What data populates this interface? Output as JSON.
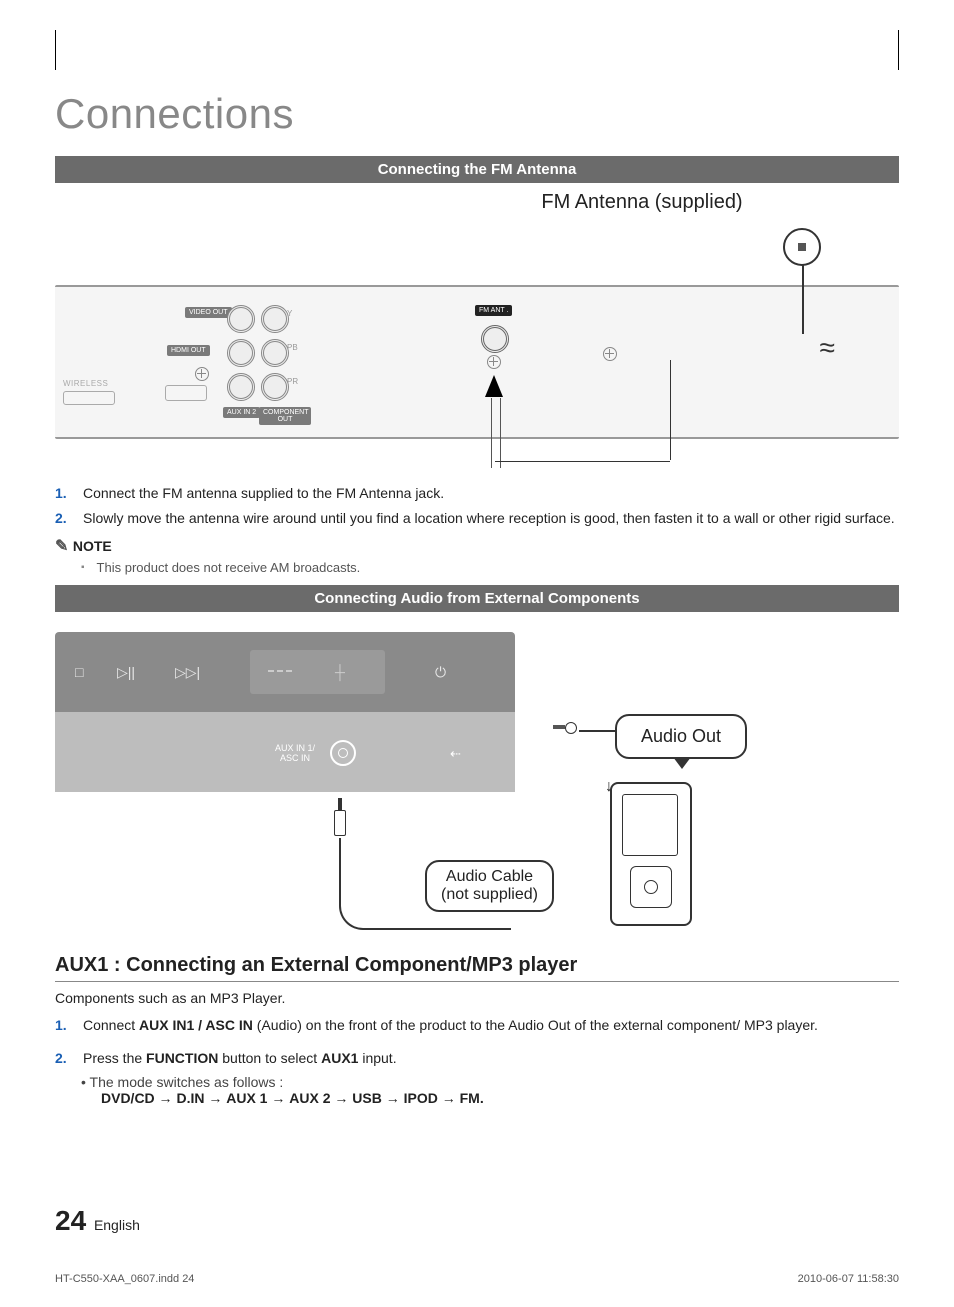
{
  "title": "Connections",
  "section1": {
    "bar": "Connecting the FM Antenna",
    "fm_label": "FM Antenna (supplied)",
    "panel": {
      "video_out": "VIDEO OUT",
      "hdmi_out": "HDMI OUT",
      "aux_in2": "AUX IN 2",
      "component_out": "COMPONENT OUT",
      "wireless": "WIRELESS",
      "fm_ant": "FM ANT .",
      "y": "Y",
      "pb": "PB",
      "pr": "PR"
    },
    "steps": [
      "Connect the FM antenna supplied to the FM Antenna jack.",
      "Slowly move the antenna wire around until you find a location where reception is good, then fasten it to a wall or other rigid surface."
    ],
    "note_label": "NOTE",
    "note_item": "This product does not receive AM broadcasts."
  },
  "section2": {
    "bar": "Connecting Audio from External Components",
    "asc_label_1": "AUX IN 1/",
    "asc_label_2": "ASC IN",
    "audio_out": "Audio Out",
    "audio_cable_1": "Audio Cable",
    "audio_cable_2": "(not supplied)",
    "h3": "AUX1 : Connecting an External Component/MP3 player",
    "intro": "Components such as an MP3 Player.",
    "step1_pre": "Connect ",
    "step1_b1": "AUX IN1 / ASC IN",
    "step1_post": " (Audio) on the front of the product to the Audio Out of the external component/ MP3 player.",
    "step2_pre": "Press the ",
    "step2_b1": "FUNCTION",
    "step2_mid": " button to select ",
    "step2_b2": "AUX1",
    "step2_post": " input.",
    "bullet": "The mode switches as follows :",
    "modes": [
      "DVD/CD",
      "D.IN",
      "AUX 1",
      "AUX 2",
      "USB",
      "IPOD",
      "FM"
    ]
  },
  "footer": {
    "page": "24",
    "lang": "English",
    "print_left": "HT-C550-XAA_0607.indd   24",
    "print_right": "2010-06-07    11:58:30"
  }
}
